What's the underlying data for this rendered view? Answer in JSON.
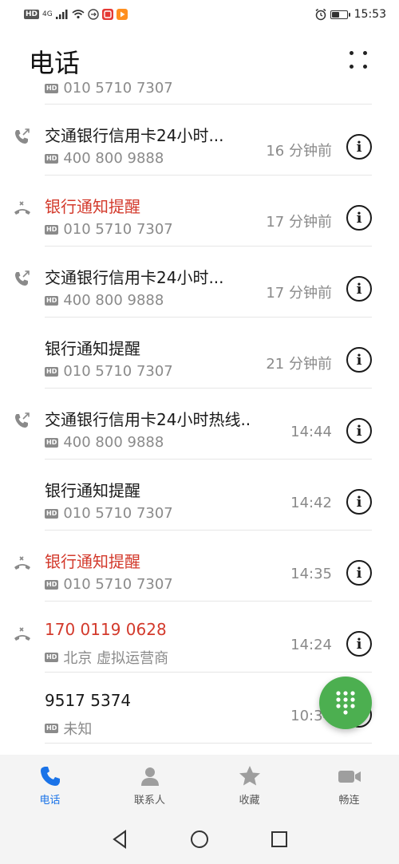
{
  "status_bar": {
    "left_badges": [
      "HD",
      "4G"
    ],
    "time": "15:53",
    "battery_level": 0.55
  },
  "header": {
    "title": "电话"
  },
  "calls": [
    {
      "name": "交通银行信用卡24小时...",
      "number": "400 800 9888",
      "time": "16 分钟前",
      "type": "outgoing",
      "missed": false
    },
    {
      "name": "银行通知提醒",
      "number": "010 5710 7307",
      "time": "17 分钟前",
      "type": "missed",
      "missed": true
    },
    {
      "name": "交通银行信用卡24小时...",
      "number": "400 800 9888",
      "time": "17 分钟前",
      "type": "outgoing",
      "missed": false
    },
    {
      "name": "银行通知提醒",
      "number": "010 5710 7307",
      "time": "21 分钟前",
      "type": "incoming",
      "missed": false
    },
    {
      "name": "交通银行信用卡24小时热线...",
      "number": "400 800 9888",
      "time": "14:44",
      "type": "outgoing",
      "missed": false
    },
    {
      "name": "银行通知提醒",
      "number": "010 5710 7307",
      "time": "14:42",
      "type": "incoming",
      "missed": false
    },
    {
      "name": "银行通知提醒",
      "number": "010 5710 7307",
      "time": "14:35",
      "type": "missed",
      "missed": true
    },
    {
      "name": "170 0119 0628",
      "number": "北京 虚拟运营商",
      "time": "14:24",
      "type": "missed",
      "missed": true
    },
    {
      "name": "9517 5374",
      "number": "未知",
      "time": "10:34",
      "type": "incoming",
      "missed": false
    }
  ],
  "partial_top_number": "010 5710 7307",
  "hd_label": "HD",
  "bottom_nav": [
    {
      "label": "电话",
      "icon": "phone-icon",
      "active": true
    },
    {
      "label": "联系人",
      "icon": "contacts-icon",
      "active": false
    },
    {
      "label": "收藏",
      "icon": "star-icon",
      "active": false
    },
    {
      "label": "畅连",
      "icon": "video-call-icon",
      "active": false
    }
  ],
  "colors": {
    "accent": "#1a73e8",
    "missed": "#d33a2c",
    "fab": "#4caf50"
  }
}
